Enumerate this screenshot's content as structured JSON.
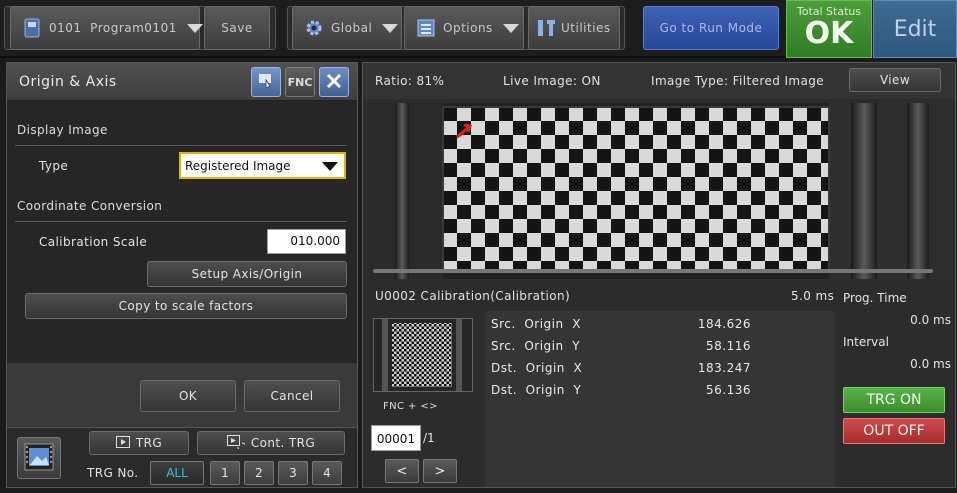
{
  "toolbar": {
    "program_label": "0101  Program0101",
    "save_label": "Save",
    "global_label": "Global",
    "options_label": "Options",
    "utilities_label": "Utilities",
    "run_mode_label": "Go to Run Mode",
    "total_status_label": "Total Status",
    "total_status_value": "OK",
    "edit_label": "Edit"
  },
  "left_panel": {
    "title": "Origin & Axis",
    "fnc_label": "FNC",
    "display_image_section": "Display Image",
    "type_label": "Type",
    "type_value": "Registered Image",
    "coordinate_section": "Coordinate Conversion",
    "calibration_scale_label": "Calibration Scale",
    "calibration_scale_value": "010.000",
    "setup_button": "Setup Axis/Origin",
    "copy_button": "Copy to scale factors",
    "ok_button": "OK",
    "cancel_button": "Cancel",
    "trg_button": "TRG",
    "cont_trg_button": "Cont. TRG",
    "trg_no_label": "TRG No.",
    "trg_numbers": [
      "ALL",
      "1",
      "2",
      "3",
      "4"
    ]
  },
  "right_panel": {
    "ratio": "Ratio: 81%",
    "live_image": "Live Image: ON",
    "image_type": "Image Type: Filtered Image",
    "view_button": "View",
    "unit_title": "U0002 Calibration(Calibration)",
    "unit_time": "5.0 ms",
    "prog_time_label": "Prog. Time",
    "prog_time_value": "0.0 ms",
    "interval_label": "Interval",
    "interval_value": "0.0 ms",
    "fnc_hint": "FNC + <>",
    "frame_value": "00001",
    "frame_total": "/1",
    "prev_button": "<",
    "next_button": ">",
    "trg_on_button": "TRG ON",
    "out_off_button": "OUT OFF",
    "results": [
      {
        "key": "Src.  Origin  X",
        "value": "184.626"
      },
      {
        "key": "Src.  Origin  Y",
        "value": "58.116"
      },
      {
        "key": "Dst.  Origin  X",
        "value": "183.247"
      },
      {
        "key": "Dst.  Origin  Y",
        "value": "56.136"
      }
    ]
  },
  "colors": {
    "status_ok": "#3f8f30",
    "run_mode": "#2f52a6",
    "edit": "#35618a",
    "trg_on": "#4aa23a",
    "out_off": "#c23a3a",
    "select_border": "#e6b400"
  }
}
